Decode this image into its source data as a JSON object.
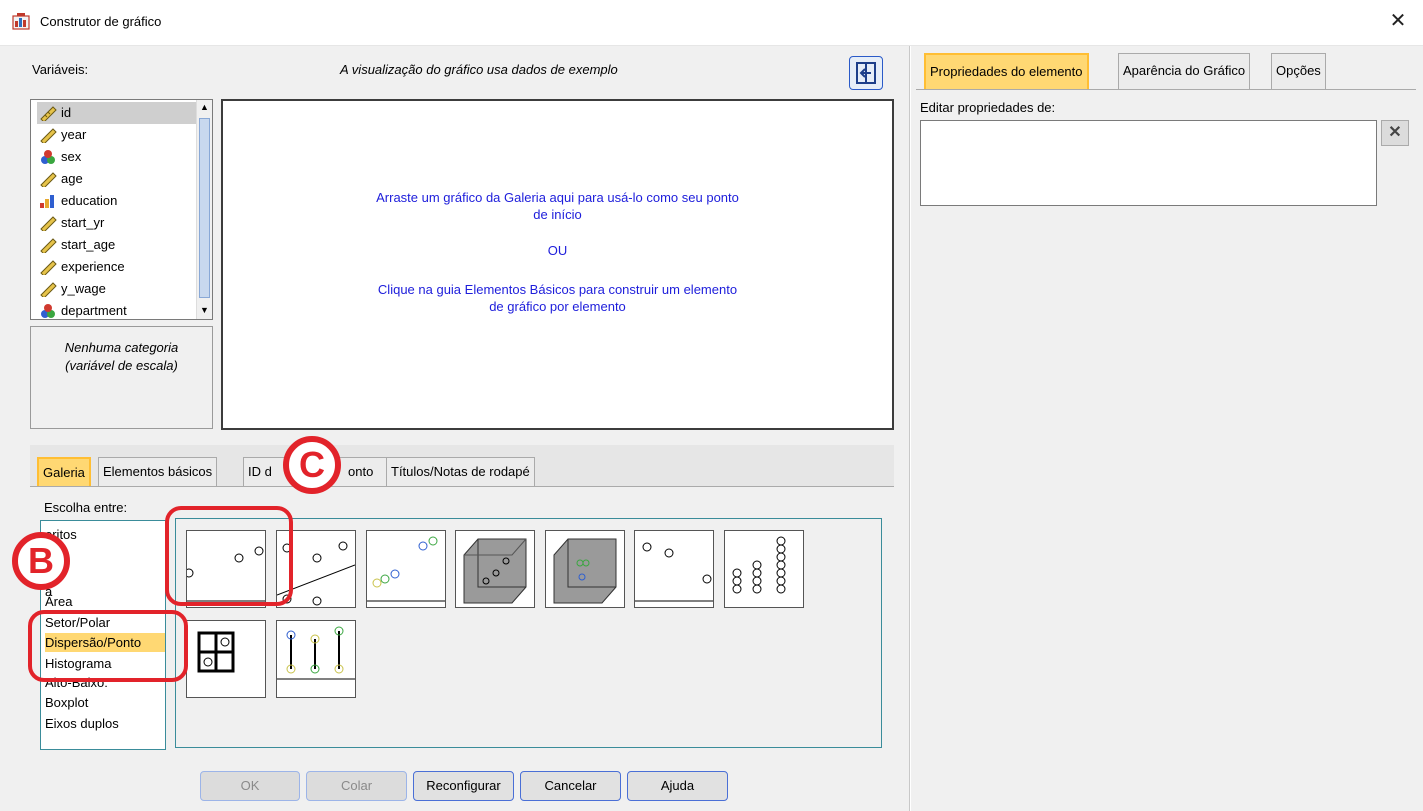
{
  "window": {
    "title": "Construtor de gráfico"
  },
  "left": {
    "variables_label": "Variáveis:",
    "preview_note": "A visualização do gráfico usa dados de exemplo",
    "variables": [
      {
        "name": "id",
        "type": "scale"
      },
      {
        "name": "year",
        "type": "scale"
      },
      {
        "name": "sex",
        "type": "nominal"
      },
      {
        "name": "age",
        "type": "scale"
      },
      {
        "name": "education",
        "type": "ordinal"
      },
      {
        "name": "start_yr",
        "type": "scale"
      },
      {
        "name": "start_age",
        "type": "scale"
      },
      {
        "name": "experience",
        "type": "scale"
      },
      {
        "name": "y_wage",
        "type": "scale"
      },
      {
        "name": "department",
        "type": "nominal"
      }
    ],
    "category_note_line1": "Nenhuma categoria",
    "category_note_line2": "(variável de escala)"
  },
  "canvas": {
    "line1": "Arraste um gráfico da Galeria aqui para usá-lo como seu ponto",
    "line2": "de início",
    "or": "OU",
    "line3": "Clique na guia Elementos Básicos para construir um elemento",
    "line4": "de gráfico por elemento"
  },
  "tabs": {
    "gallery": "Galeria",
    "basic": "Elementos básicos",
    "groups": "ID d",
    "groups_tail": "onto",
    "titles": "Títulos/Notas de rodapé"
  },
  "gallery": {
    "choose_label": "Escolha entre:",
    "items": [
      "oritos",
      "",
      "",
      "a",
      "Área",
      "Setor/Polar",
      "Dispersão/Ponto",
      "Histograma",
      "Alto-Baixo:",
      "Boxplot",
      "Eixos duplos"
    ],
    "selected": "Dispersão/Ponto"
  },
  "buttons": {
    "ok": "OK",
    "paste": "Colar",
    "reset": "Reconfigurar",
    "cancel": "Cancelar",
    "help": "Ajuda"
  },
  "right": {
    "tabs": [
      "Propriedades do elemento",
      "Aparência do Gráfico",
      "Opções"
    ],
    "edit_label": "Editar propriedades de:"
  },
  "annotations": {
    "b": "B",
    "c": "C"
  },
  "colors": {
    "highlight": "#e2232a",
    "accent_tab": "#ffd873",
    "canvas_text": "#1d1ddb"
  }
}
